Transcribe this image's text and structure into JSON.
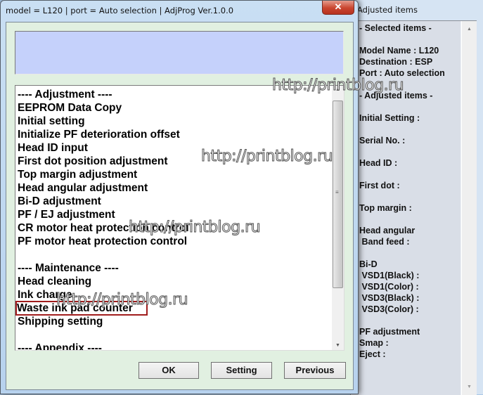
{
  "main_window": {
    "title": "model = L120 | port = Auto selection | AdjProg Ver.1.0.0",
    "close_label": "✕",
    "message_box": "",
    "list_items": [
      "---- Adjustment ----",
      "EEPROM Data Copy",
      "Initial setting",
      "Initialize PF deterioration offset",
      "Head ID input",
      "First dot position adjustment",
      "Top margin adjustment",
      "Head angular adjustment",
      "Bi-D adjustment",
      "PF / EJ adjustment",
      "CR motor heat protection control",
      "PF motor heat protection control",
      "",
      "---- Maintenance ----",
      "Head cleaning",
      "Ink charge",
      "Waste ink pad counter",
      "Shipping setting",
      "",
      "---- Appendix ----"
    ],
    "highlighted_item": "Waste ink pad counter",
    "buttons": {
      "ok": "OK",
      "setting": "Setting",
      "previous": "Previous"
    }
  },
  "side_window": {
    "title": "Adjusted items",
    "lines": [
      "- Selected items -",
      "",
      "Model Name : L120",
      "Destination : ESP",
      "Port : Auto selection",
      "",
      "- Adjusted items -",
      "",
      "Initial Setting :",
      "",
      "Serial No. :",
      "",
      "Head ID :",
      "",
      "First dot :",
      "",
      "Top margin :",
      "",
      "Head angular",
      " Band feed :",
      "",
      "Bi-D",
      " VSD1(Black) :",
      " VSD1(Color) :",
      " VSD3(Black) :",
      " VSD3(Color) :",
      "",
      "PF adjustment",
      "Smap :",
      "Eject :"
    ]
  },
  "watermarks": [
    "http://printblog.ru",
    "http://printblog.ru",
    "http://printblog.ru",
    "http://printblog.ru"
  ]
}
